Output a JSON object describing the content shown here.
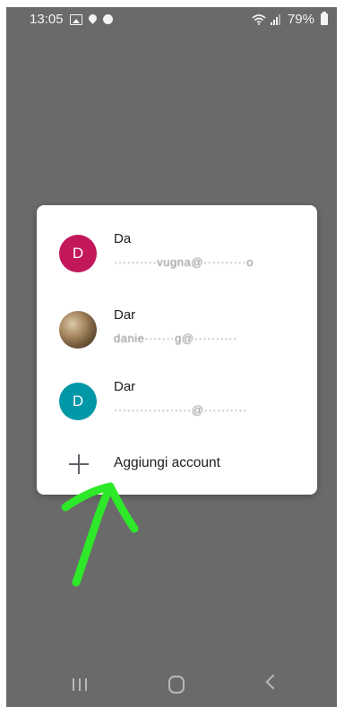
{
  "status_bar": {
    "time": "13:05",
    "battery": "79%"
  },
  "dialog": {
    "accounts": [
      {
        "initial": "D",
        "name": "Da",
        "email": "··········vugna@··········o",
        "avatar_color": "#c2185b"
      },
      {
        "initial": "",
        "name": "Dar",
        "email": "danie·······g@··········",
        "avatar_color": "#8d6e4a"
      },
      {
        "initial": "D",
        "name": "Dar",
        "email": "··················@··········",
        "avatar_color": "#0097a7"
      }
    ],
    "add_account_label": "Aggiungi account"
  },
  "colors": {
    "overlay_background": "#6a6a6a",
    "annotation_arrow": "#2ee82a"
  }
}
